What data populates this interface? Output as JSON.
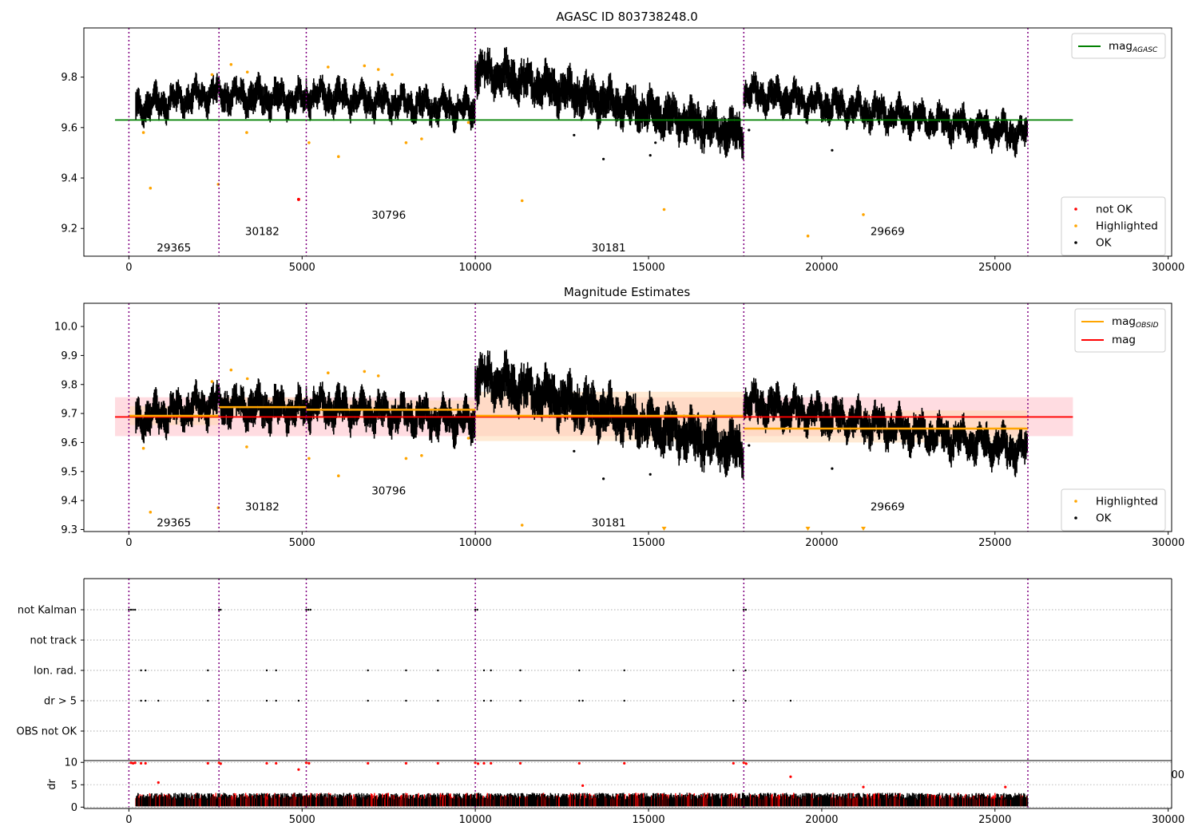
{
  "colors": {
    "ok": "#000000",
    "highlighted": "#ffa500",
    "not_ok": "#ff0000",
    "agasc_line": "#008000",
    "mag_line": "#ff0000",
    "obsid_line": "#ffa500",
    "obs_boundary": "#800080",
    "band_red": "#ffc0c8",
    "band_orange": "#ffd8b0"
  },
  "chart_data": [
    {
      "id": "agasc",
      "type": "scatter",
      "title": "AGASC ID 803738248.0",
      "xlim": [
        -1300,
        30100
      ],
      "ylim": [
        9.09,
        9.995
      ],
      "xticks": [
        0,
        5000,
        10000,
        15000,
        20000,
        25000,
        30000
      ],
      "xtick_labels": [
        "0",
        "5000",
        "10000",
        "15000",
        "20000",
        "25000",
        "30000"
      ],
      "yticks": [
        9.2,
        9.4,
        9.6,
        9.8
      ],
      "ytick_labels": [
        "9.2",
        "9.4",
        "9.6",
        "9.8"
      ],
      "obs_boundaries": [
        0,
        2600,
        5120,
        10000,
        17750,
        25950
      ],
      "obs_labels": [
        {
          "text": "29365",
          "x": 1300,
          "y": 9.125
        },
        {
          "text": "30182",
          "x": 3850,
          "y": 9.19
        },
        {
          "text": "30796",
          "x": 7500,
          "y": 9.255
        },
        {
          "text": "30181",
          "x": 13850,
          "y": 9.125
        },
        {
          "text": "29669",
          "x": 21900,
          "y": 9.19
        }
      ],
      "mag_agasc": 9.63,
      "segments": [
        {
          "x0": 200,
          "x1": 2600,
          "start": 9.68,
          "end": 9.74,
          "spread": 0.06
        },
        {
          "x0": 2600,
          "x1": 5120,
          "start": 9.73,
          "end": 9.71,
          "spread": 0.06
        },
        {
          "x0": 5120,
          "x1": 10000,
          "start": 9.73,
          "end": 9.67,
          "spread": 0.06
        },
        {
          "x0": 10000,
          "x1": 17750,
          "start": 9.83,
          "end": 9.57,
          "spread": 0.08
        },
        {
          "x0": 17750,
          "x1": 25950,
          "start": 9.74,
          "end": 9.57,
          "spread": 0.06
        }
      ],
      "highlighted_points": [
        [
          420,
          9.58
        ],
        [
          620,
          9.36
        ],
        [
          2400,
          9.81
        ],
        [
          2580,
          9.375
        ],
        [
          2950,
          9.85
        ],
        [
          3400,
          9.58
        ],
        [
          3420,
          9.82
        ],
        [
          5200,
          9.54
        ],
        [
          5750,
          9.84
        ],
        [
          6050,
          9.485
        ],
        [
          6800,
          9.845
        ],
        [
          7200,
          9.83
        ],
        [
          7600,
          9.81
        ],
        [
          8000,
          9.54
        ],
        [
          8450,
          9.555
        ],
        [
          9800,
          9.62
        ],
        [
          11350,
          9.31
        ],
        [
          15450,
          9.275
        ],
        [
          19600,
          9.17
        ],
        [
          21200,
          9.255
        ]
      ],
      "not_ok_points": [
        [
          4900,
          9.315
        ]
      ],
      "outlier_points": [
        [
          12850,
          9.57
        ],
        [
          13700,
          9.475
        ],
        [
          15050,
          9.49
        ],
        [
          15200,
          9.54
        ],
        [
          17900,
          9.59
        ],
        [
          20300,
          9.51
        ]
      ],
      "legend_top": [
        {
          "label": "mag",
          "sub": "AGASC",
          "color": "#008000"
        }
      ],
      "legend_bottom": [
        {
          "label": "not OK",
          "color": "#ff0000"
        },
        {
          "label": "Highlighted",
          "color": "#ffa500"
        },
        {
          "label": "OK",
          "color": "#000000"
        }
      ]
    },
    {
      "id": "estimates",
      "type": "scatter",
      "title": "Magnitude Estimates",
      "xlim": [
        -1300,
        30100
      ],
      "ylim": [
        9.293,
        10.08
      ],
      "xticks": [
        0,
        5000,
        10000,
        15000,
        20000,
        25000,
        30000
      ],
      "xtick_labels": [
        "0",
        "5000",
        "10000",
        "15000",
        "20000",
        "25000",
        "30000"
      ],
      "yticks": [
        9.3,
        9.4,
        9.5,
        9.6,
        9.7,
        9.8,
        9.9,
        10.0
      ],
      "ytick_labels": [
        "9.3",
        "9.4",
        "9.5",
        "9.6",
        "9.7",
        "9.8",
        "9.9",
        "10.0"
      ],
      "obs_boundaries": [
        0,
        2600,
        5120,
        10000,
        17750,
        25950
      ],
      "obs_labels": [
        {
          "text": "29365",
          "x": 1300,
          "y": 9.325
        },
        {
          "text": "30182",
          "x": 3850,
          "y": 9.38
        },
        {
          "text": "30796",
          "x": 7500,
          "y": 9.435
        },
        {
          "text": "30181",
          "x": 13850,
          "y": 9.325
        },
        {
          "text": "29669",
          "x": 21900,
          "y": 9.38
        }
      ],
      "mag": {
        "value": 9.688,
        "band": [
          9.622,
          9.756
        ],
        "x_end": 27250
      },
      "mag_obsid": [
        {
          "x0": 0,
          "x1": 2600,
          "value": 9.692,
          "band": [
            9.66,
            9.725
          ]
        },
        {
          "x0": 2600,
          "x1": 5120,
          "value": 9.722,
          "band": [
            9.69,
            9.755
          ]
        },
        {
          "x0": 5120,
          "x1": 10000,
          "value": 9.713,
          "band": [
            9.68,
            9.745
          ]
        },
        {
          "x0": 10000,
          "x1": 17750,
          "value": 9.692,
          "band": [
            9.605,
            9.775
          ]
        },
        {
          "x0": 17750,
          "x1": 25950,
          "value": 9.648,
          "band": [
            9.6,
            9.71
          ]
        }
      ],
      "segments": [
        {
          "x0": 200,
          "x1": 2600,
          "start": 9.68,
          "end": 9.74,
          "spread": 0.06
        },
        {
          "x0": 2600,
          "x1": 5120,
          "start": 9.73,
          "end": 9.71,
          "spread": 0.06
        },
        {
          "x0": 5120,
          "x1": 10000,
          "start": 9.73,
          "end": 9.67,
          "spread": 0.06
        },
        {
          "x0": 10000,
          "x1": 17750,
          "start": 9.83,
          "end": 9.57,
          "spread": 0.08
        },
        {
          "x0": 17750,
          "x1": 25950,
          "start": 9.74,
          "end": 9.57,
          "spread": 0.06
        }
      ],
      "highlighted_points": [
        [
          420,
          9.58
        ],
        [
          620,
          9.36
        ],
        [
          2400,
          9.81
        ],
        [
          2580,
          9.375
        ],
        [
          2950,
          9.85
        ],
        [
          3400,
          9.585
        ],
        [
          3420,
          9.82
        ],
        [
          5200,
          9.545
        ],
        [
          5750,
          9.84
        ],
        [
          6050,
          9.485
        ],
        [
          6800,
          9.845
        ],
        [
          7200,
          9.83
        ],
        [
          8000,
          9.545
        ],
        [
          8450,
          9.555
        ],
        [
          9800,
          9.615
        ],
        [
          11350,
          9.315
        ]
      ],
      "offscale_markers": [
        15450,
        19600,
        21200
      ],
      "outlier_points": [
        [
          12850,
          9.57
        ],
        [
          13700,
          9.475
        ],
        [
          15050,
          9.49
        ],
        [
          17900,
          9.59
        ],
        [
          20300,
          9.51
        ]
      ],
      "legend_top": [
        {
          "label": "mag",
          "sub": "OBSID",
          "color": "#ffa500"
        },
        {
          "label": "mag",
          "sub": "",
          "color": "#ff0000"
        }
      ],
      "legend_bottom": [
        {
          "label": "Highlighted",
          "color": "#ffa500"
        },
        {
          "label": "OK",
          "color": "#000000"
        }
      ]
    },
    {
      "id": "flags",
      "type": "scatter",
      "xlim": [
        -1300,
        30100
      ],
      "categories": [
        "not Kalman",
        "not track",
        "Ion. rad.",
        "dr > 5",
        "OBS not OK"
      ],
      "obs_boundaries": [
        0,
        2600,
        5120,
        10000,
        17750,
        25950
      ],
      "flag_points": {
        "not Kalman": [
          0,
          60,
          120,
          180,
          2600,
          2650,
          5120,
          5180,
          5240,
          10000,
          10060,
          17750,
          17810
        ],
        "not track": [],
        "Ion. rad.": [
          350,
          480,
          2280,
          3980,
          4250,
          6900,
          8000,
          8920,
          10250,
          10450,
          11300,
          13000,
          14300,
          17450,
          17800
        ],
        "dr > 5": [
          350,
          480,
          850,
          2280,
          3980,
          4250,
          4900,
          6900,
          8000,
          8920,
          10250,
          10450,
          11300,
          13000,
          13100,
          14300,
          17450,
          17800,
          19100
        ],
        "OBS not OK": []
      },
      "clipped_tick_label": "00"
    },
    {
      "id": "dr",
      "type": "scatter",
      "ylabel": "dr",
      "xlim": [
        -1300,
        30100
      ],
      "ylim": [
        -0.3,
        10.4
      ],
      "xticks": [
        0,
        5000,
        10000,
        15000,
        20000,
        25000,
        30000
      ],
      "xtick_labels": [
        "0",
        "5000",
        "10000",
        "15000",
        "20000",
        "25000",
        "30000"
      ],
      "yticks": [
        0,
        5,
        10
      ],
      "ytick_labels": [
        "0",
        "5",
        "10"
      ],
      "obs_boundaries": [
        0,
        2600,
        5120,
        10000,
        17750,
        25950
      ],
      "dr_high_points": [
        [
          60,
          9.9
        ],
        [
          120,
          9.8
        ],
        [
          180,
          9.9
        ],
        [
          350,
          9.8
        ],
        [
          480,
          9.8
        ],
        [
          2280,
          9.8
        ],
        [
          2600,
          9.9
        ],
        [
          2650,
          9.7
        ],
        [
          3980,
          9.8
        ],
        [
          4250,
          9.8
        ],
        [
          4900,
          8.4
        ],
        [
          5120,
          9.9
        ],
        [
          5200,
          9.8
        ],
        [
          6900,
          9.8
        ],
        [
          8000,
          9.8
        ],
        [
          8920,
          9.8
        ],
        [
          10000,
          9.9
        ],
        [
          10080,
          9.7
        ],
        [
          10250,
          9.8
        ],
        [
          10450,
          9.8
        ],
        [
          11300,
          9.8
        ],
        [
          13000,
          9.8
        ],
        [
          14300,
          9.8
        ],
        [
          17450,
          9.8
        ],
        [
          17750,
          9.9
        ],
        [
          17820,
          9.7
        ],
        [
          850,
          5.5
        ],
        [
          13100,
          4.8
        ],
        [
          19100,
          6.8
        ],
        [
          21200,
          4.5
        ],
        [
          25300,
          4.5
        ]
      ],
      "segments_range": [
        200,
        25950
      ]
    }
  ]
}
